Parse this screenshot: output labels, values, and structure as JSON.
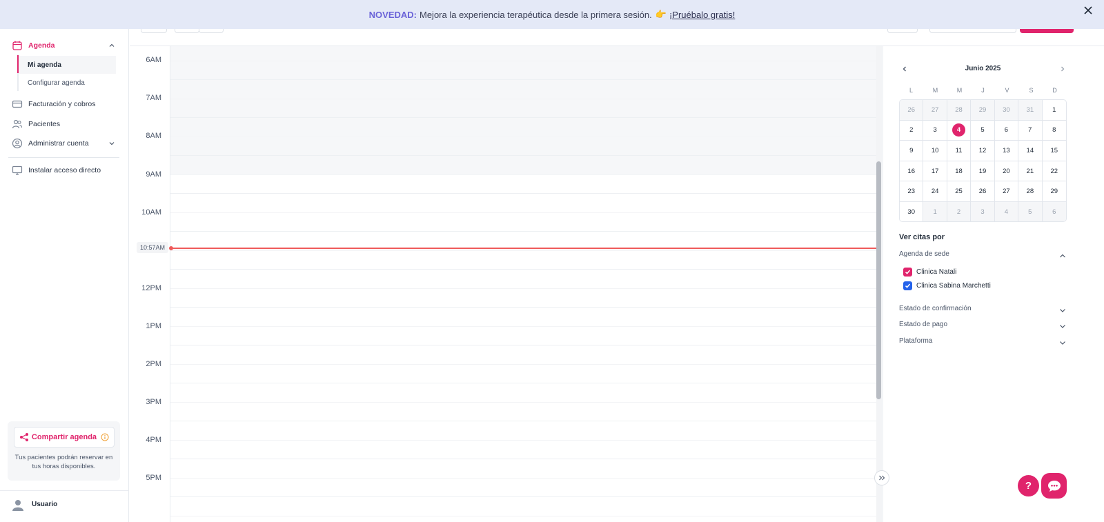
{
  "banner": {
    "tag": "NOVEDAD:",
    "message": "Mejora la experiencia terapéutica desde la primera sesión.",
    "emoji": "👉",
    "cta": "¡Pruébalo gratis!",
    "close_icon": "close-icon"
  },
  "sidebar": {
    "agenda": "Agenda",
    "sub_items": [
      "Mi agenda",
      "Configurar agenda"
    ],
    "billing": "Facturación y cobros",
    "patients": "Pacientes",
    "account": "Administrar cuenta",
    "install": "Instalar acceso directo",
    "share": {
      "label": "Compartir agenda",
      "hint": "Tus pacientes podrán reservar en tus horas disponibles."
    },
    "user": "Usuario"
  },
  "calendar": {
    "hours": [
      "6AM",
      "7AM",
      "8AM",
      "9AM",
      "10AM",
      "12PM",
      "1PM",
      "2PM",
      "3PM",
      "4PM",
      "5PM"
    ],
    "now_label": "10:57AM"
  },
  "mini_calendar": {
    "title": "Junio 2025",
    "weekdays": [
      "L",
      "M",
      "M",
      "J",
      "V",
      "S",
      "D"
    ],
    "weeks": [
      [
        "26",
        "27",
        "28",
        "29",
        "30",
        "31",
        "1"
      ],
      [
        "2",
        "3",
        "4",
        "5",
        "6",
        "7",
        "8"
      ],
      [
        "9",
        "10",
        "11",
        "12",
        "13",
        "14",
        "15"
      ],
      [
        "16",
        "17",
        "18",
        "19",
        "20",
        "21",
        "22"
      ],
      [
        "23",
        "24",
        "25",
        "26",
        "27",
        "28",
        "29"
      ],
      [
        "30",
        "1",
        "2",
        "3",
        "4",
        "5",
        "6"
      ]
    ],
    "today": "4"
  },
  "filters": {
    "title": "Ver citas por",
    "site_agenda": "Agenda de sede",
    "clinics": [
      {
        "name": "Clinica Natali",
        "color": "#e0246c"
      },
      {
        "name": "Clinica Sabina Marchetti",
        "color": "#2563eb"
      }
    ],
    "confirmation": "Estado de confirmación",
    "payment": "Estado de pago",
    "platform": "Plataforma"
  },
  "fab": {
    "help": "?"
  },
  "colors": {
    "accent": "#e0246c",
    "now_line": "#ef5a5a",
    "banner_bg": "#e4e9f7"
  }
}
